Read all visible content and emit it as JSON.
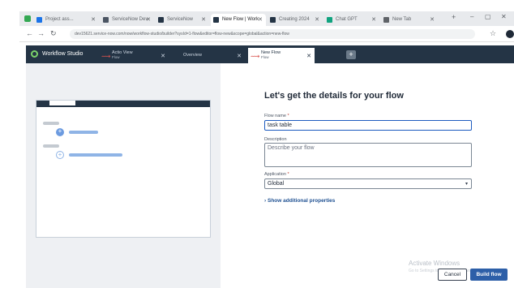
{
  "browser": {
    "tabs": [
      {
        "label": "Project ass..."
      },
      {
        "label": "ServiceNow Dev"
      },
      {
        "label": "ServiceNow"
      },
      {
        "label": "New Flow | Work",
        "active": true
      },
      {
        "label": "Creating 2024"
      },
      {
        "label": "Chat GPT"
      },
      {
        "label": "New Tab"
      }
    ],
    "url": "dev15621.service-now.com/now/workflow-studio/builder?sysId=1-flow&editor=flow-new&scope=global&action=new-flow",
    "new_tab_symbol": "+",
    "window_controls": [
      "–",
      "▢",
      "✕"
    ]
  },
  "app": {
    "brand": "Workflow Studio",
    "tabs": [
      {
        "label": "Actio View",
        "sub": "Flow",
        "icon": "flow-icon"
      },
      {
        "label": "Overview",
        "sub": "",
        "icon": ""
      },
      {
        "label": "New Flow",
        "sub": "Flow",
        "icon": "flow-icon",
        "active": true
      }
    ]
  },
  "form": {
    "title": "Let's get the details for your flow",
    "flow_name_label": "Flow name",
    "flow_name_value": "task table",
    "description_label": "Description",
    "description_placeholder": "Describe your flow",
    "application_label": "Application",
    "application_value": "Global",
    "show_props": "Show additional properties",
    "cancel": "Cancel",
    "build": "Build flow",
    "required_marker": "*"
  },
  "watermark": {
    "line1": "Activate Windows",
    "line2": "Go to Settings to activate Windows."
  },
  "colors": {
    "header_bg": "#243445",
    "primary_button": "#2d5fa8",
    "focus_border": "#1d5bbf"
  }
}
